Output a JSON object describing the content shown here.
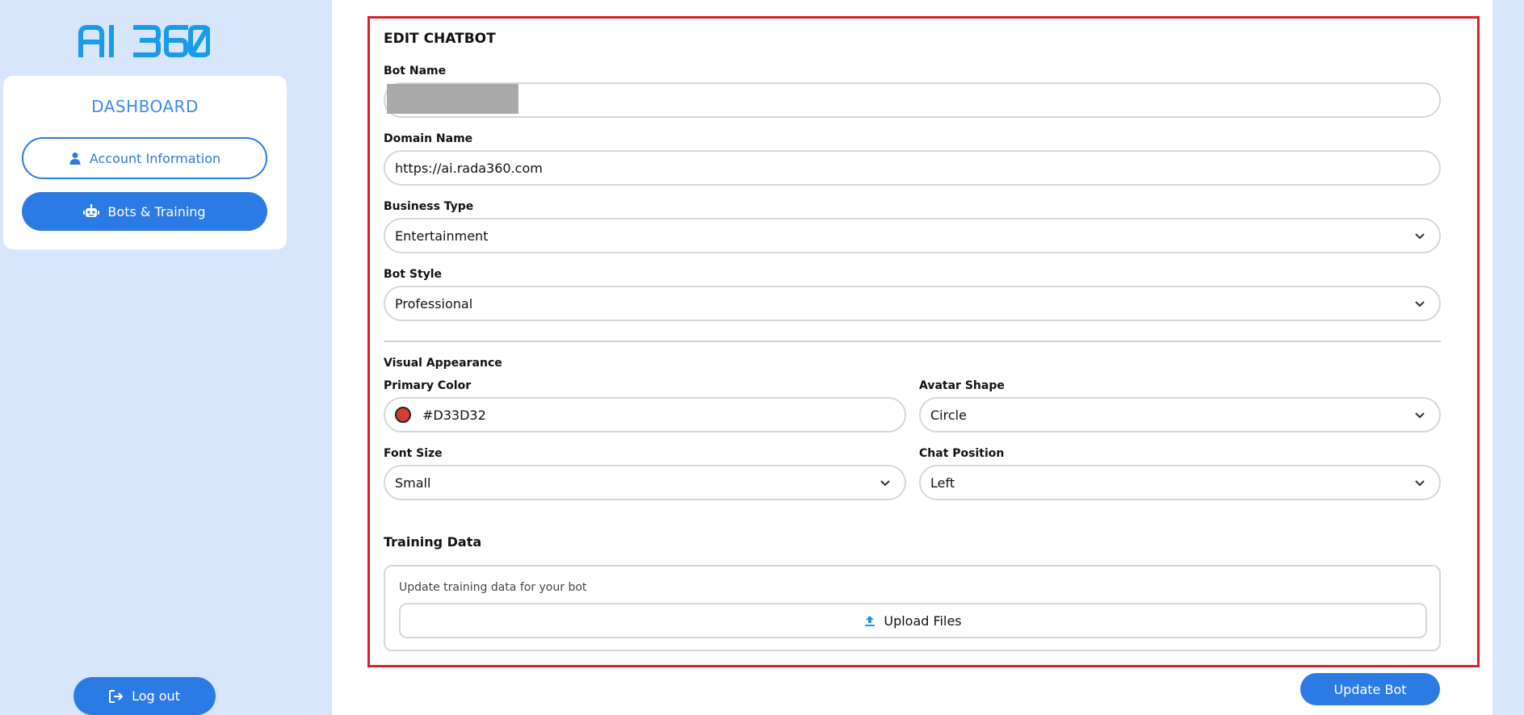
{
  "brand": {
    "logo_text": "AI 360",
    "color": "#1a9be8"
  },
  "sidebar": {
    "title": "DASHBOARD",
    "items": [
      {
        "label": "Account Information",
        "icon": "user-icon",
        "active": false
      },
      {
        "label": "Bots & Training",
        "icon": "robot-icon",
        "active": true
      }
    ],
    "logout_label": "Log out"
  },
  "form": {
    "heading": "EDIT CHATBOT",
    "bot_name": {
      "label": "Bot Name",
      "value": ""
    },
    "domain_name": {
      "label": "Domain Name",
      "value": "https://ai.rada360.com"
    },
    "business_type": {
      "label": "Business Type",
      "value": "Entertainment"
    },
    "bot_style": {
      "label": "Bot Style",
      "value": "Professional"
    },
    "visual_heading": "Visual Appearance",
    "primary_color": {
      "label": "Primary Color",
      "value": "#D33D32"
    },
    "avatar_shape": {
      "label": "Avatar Shape",
      "value": "Circle"
    },
    "font_size": {
      "label": "Font Size",
      "value": "Small"
    },
    "chat_position": {
      "label": "Chat Position",
      "value": "Left"
    },
    "training": {
      "heading": "Training Data",
      "hint": "Update training data for your bot",
      "upload_label": "Upload Files"
    },
    "update_label": "Update Bot"
  },
  "colors": {
    "accent": "#2c7be5",
    "highlight_border": "#d9202a",
    "background": "#d8e6fb"
  }
}
